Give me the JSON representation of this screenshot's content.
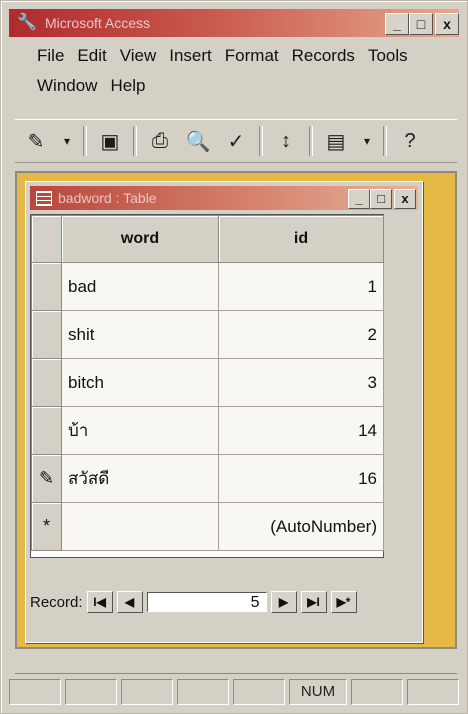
{
  "app": {
    "title": "Microsoft Access"
  },
  "menu": {
    "row1": [
      "File",
      "Edit",
      "View",
      "Insert",
      "Format",
      "Records",
      "Tools"
    ],
    "row2": [
      "Window",
      "Help"
    ]
  },
  "title_buttons": {
    "minimize": "_",
    "maximize": "□",
    "close": "x"
  },
  "toolbar": {
    "icons": [
      "design-view-icon",
      "dropdown-arrow-icon",
      "save-icon",
      "print-icon",
      "print-preview-icon",
      "spelling-icon",
      "sort-icon",
      "new-object-icon",
      "dropdown-arrow-icon",
      "help-icon"
    ]
  },
  "table_window": {
    "title": "badword : Table",
    "columns": [
      "word",
      "id"
    ],
    "rows": [
      {
        "selector": "",
        "word": "bad",
        "id": "1"
      },
      {
        "selector": "",
        "word": "shit",
        "id": "2"
      },
      {
        "selector": "",
        "word": "bitch",
        "id": "3"
      },
      {
        "selector": "",
        "word": "บ้า",
        "id": "14"
      },
      {
        "selector": "✎",
        "word": "สวัสดี",
        "id": "16"
      },
      {
        "selector": "*",
        "word": "",
        "id": "(AutoNumber)"
      }
    ]
  },
  "navigation": {
    "label": "Record:",
    "current": "5"
  },
  "statusbar": {
    "panels": [
      "",
      "",
      "",
      "",
      "",
      "NUM",
      "",
      ""
    ]
  },
  "colors": {
    "title_gradient_start": "#b02a2e",
    "workspace": "#e4b945"
  }
}
